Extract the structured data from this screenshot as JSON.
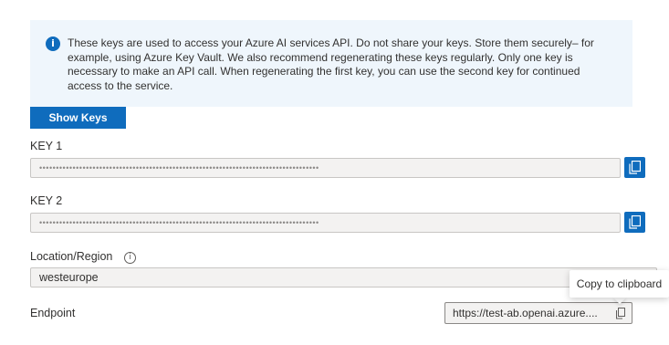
{
  "info": {
    "icon": "info-icon",
    "text": "These keys are used to access your Azure AI services API. Do not share your keys. Store them securely– for example, using Azure Key Vault. We also recommend regenerating these keys regularly. Only one key is necessary to make an API call. When regenerating the first key, you can use the second key for continued access to the service."
  },
  "show_keys_label": "Show Keys",
  "key1": {
    "label": "KEY 1",
    "value": "••••••••••••••••••••••••••••••••••••••••••••••••••••••••••••••••••••••••••••••••••••"
  },
  "key2": {
    "label": "KEY 2",
    "value": "••••••••••••••••••••••••••••••••••••••••••••••••••••••••••••••••••••••••••••••••••••"
  },
  "location": {
    "label": "Location/Region",
    "info_glyph": "i",
    "value": "westeurope"
  },
  "endpoint": {
    "label": "Endpoint",
    "value": "https://test-ab.openai.azure...."
  },
  "tooltip": "Copy to clipboard",
  "colors": {
    "accent": "#0f6cbd",
    "info_bg": "#eff6fc",
    "field_bg": "#f3f2f1"
  }
}
